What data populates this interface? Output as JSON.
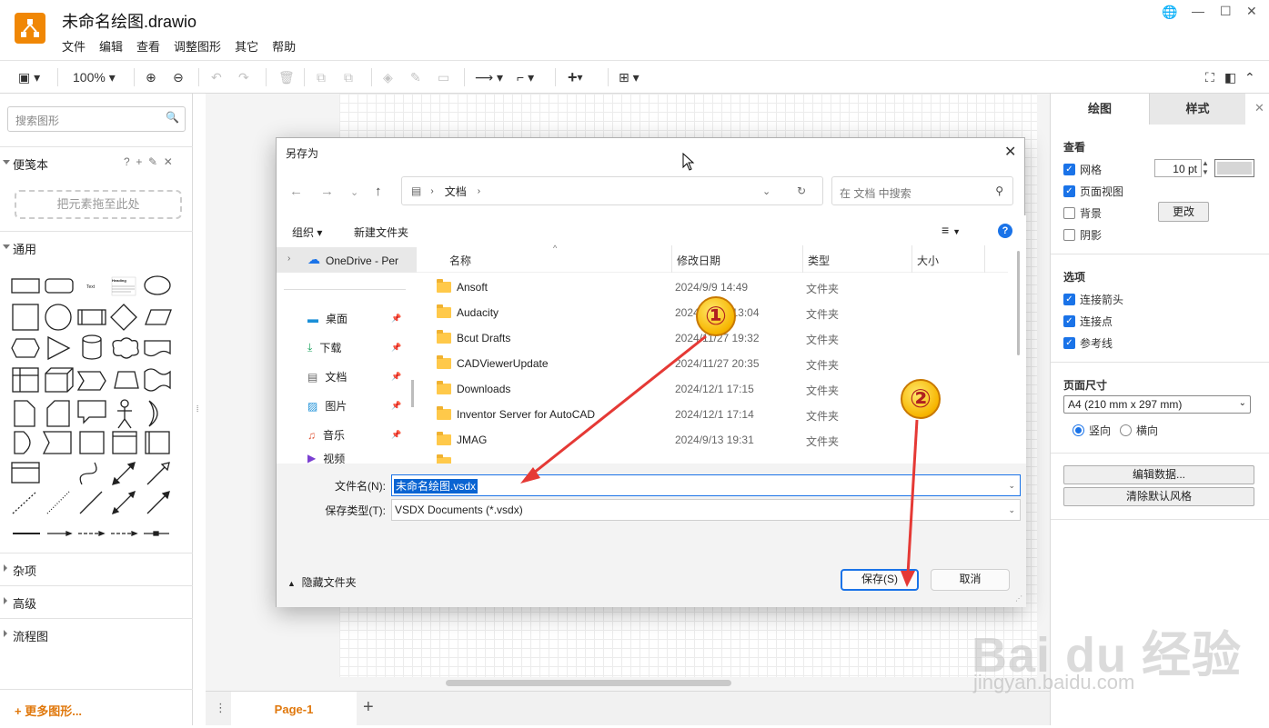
{
  "app": {
    "title": "未命名绘图.drawio",
    "menu": [
      "文件",
      "编辑",
      "查看",
      "调整图形",
      "其它",
      "帮助"
    ]
  },
  "toolbar": {
    "zoom": "100%"
  },
  "sidebar": {
    "search_placeholder": "搜索图形",
    "scratchpad_title": "便笺本",
    "drop_hint": "把元素拖至此处",
    "general_title": "通用",
    "misc_title": "杂项",
    "advanced_title": "高级",
    "flowchart_title": "流程图",
    "more_shapes": "+ 更多图形...",
    "shape_label_text": "Text",
    "shape_label_heading": "Heading"
  },
  "pagebar": {
    "tab": "Page-1"
  },
  "format_panel": {
    "tab_diagram": "绘图",
    "tab_style": "样式",
    "view_title": "查看",
    "grid": "网格",
    "grid_size": "10 pt",
    "page_view": "页面视图",
    "background": "背景",
    "change": "更改",
    "shadow": "阴影",
    "options_title": "选项",
    "connection_arrows": "连接箭头",
    "connection_points": "连接点",
    "guides": "参考线",
    "paper_size_title": "页面尺寸",
    "paper_size": "A4 (210 mm x 297 mm)",
    "portrait": "竖向",
    "landscape": "横向",
    "edit_data": "编辑数据...",
    "clear_style": "清除默认风格"
  },
  "dialog": {
    "title": "另存为",
    "address_folder": "文档",
    "search_placeholder": "在 文档 中搜索",
    "organize": "组织",
    "new_folder": "新建文件夹",
    "nav_items": [
      {
        "label": "OneDrive - Per"
      },
      {
        "label": "桌面"
      },
      {
        "label": "下载"
      },
      {
        "label": "文档"
      },
      {
        "label": "图片"
      },
      {
        "label": "音乐"
      },
      {
        "label": "视频"
      }
    ],
    "columns": {
      "name": "名称",
      "date": "修改日期",
      "type": "类型",
      "size": "大小"
    },
    "files": [
      {
        "name": "Ansoft",
        "date": "2024/9/9 14:49",
        "type": "文件夹"
      },
      {
        "name": "Audacity",
        "date": "2024/11/25 13:04",
        "type": "文件夹"
      },
      {
        "name": "Bcut Drafts",
        "date": "2024/11/27 19:32",
        "type": "文件夹"
      },
      {
        "name": "CADViewerUpdate",
        "date": "2024/11/27 20:35",
        "type": "文件夹"
      },
      {
        "name": "Downloads",
        "date": "2024/12/1 17:15",
        "type": "文件夹"
      },
      {
        "name": "Inventor Server for AutoCAD",
        "date": "2024/12/1 17:14",
        "type": "文件夹"
      },
      {
        "name": "JMAG",
        "date": "2024/9/13 19:31",
        "type": "文件夹"
      }
    ],
    "filename_label": "文件名(N):",
    "filename_value": "未命名绘图.vsdx",
    "filetype_label": "保存类型(T):",
    "filetype_value": "VSDX Documents (*.vsdx)",
    "hide_folders": "隐藏文件夹",
    "save": "保存(S)",
    "cancel": "取消"
  },
  "annotations": {
    "one": "①",
    "two": "②"
  },
  "watermark": {
    "brand": "Bai du 经验",
    "url": "jingyan.baidu.com"
  },
  "colors": {
    "accent": "#f08705",
    "selection": "#0a64d2",
    "arrow": "#e53935"
  }
}
